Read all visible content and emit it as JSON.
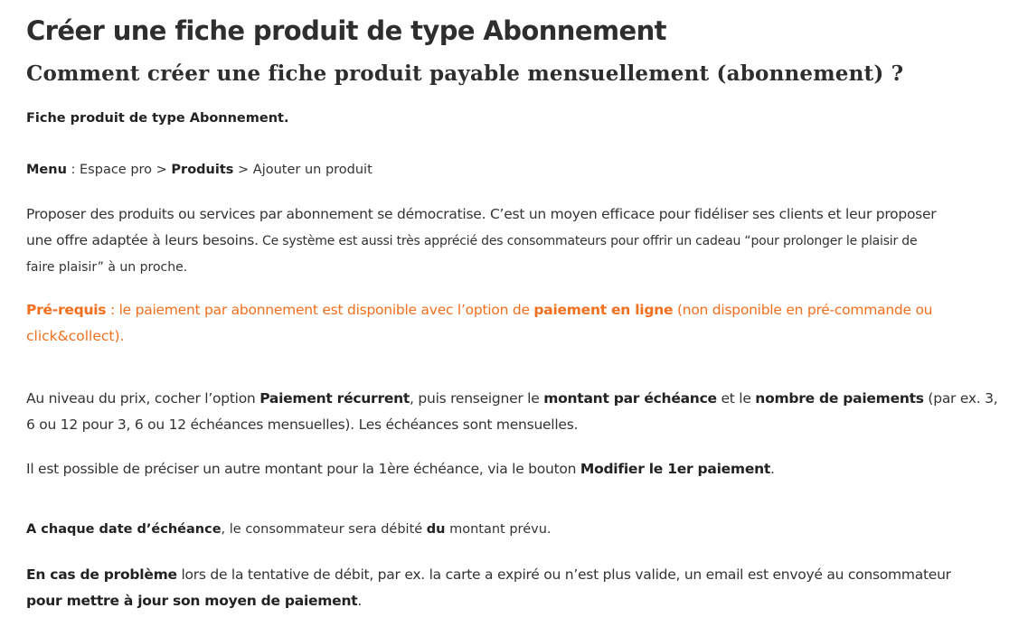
{
  "title": "Créer une fiche produit de type Abonnement",
  "subtitle": "Comment créer une fiche produit payable mensuellement (abonnement) ?",
  "intro": "Fiche produit de type Abonnement.",
  "breadcrumb": {
    "menu_label": "Menu",
    "sep1": " : Espace pro > ",
    "produits_label": "Produits",
    "sep2": " > Ajouter un produit"
  },
  "para1": {
    "line1": "Proposer des produits ou services par abonnement se démocratise. C’est un moyen efficace pour fidéliser ses clients et leur proposer",
    "line2a": "une offre adaptée à leurs besoins.",
    "line2b": " Ce système est aussi très apprécié des consommateurs pour offrir un cadeau “pour prolonger le plaisir de",
    "line3": "faire plaisir” à un proche."
  },
  "prerequis": {
    "label": "Pré-requis",
    "text1": " : le paiement par abonnement est disponible avec l’option de ",
    "bold": "paiement en ligne",
    "text2": " (non disponible en pré-commande ou",
    "line2": "click&collect)."
  },
  "para_prix": {
    "t1": "Au niveau du prix, cocher l’option ",
    "b1": "Paiement récurrent",
    "t2": ", puis renseigner le ",
    "b2": "montant par échéance",
    "t3": " et le ",
    "b3": "nombre de paiements",
    "t4": " (par ex. 3,",
    "line2": "6 ou 12 pour 3, 6 ou 12 échéances mensuelles). Les échéances sont mensuelles."
  },
  "para_modif": {
    "t1": "Il est possible de préciser un autre montant pour la 1ère échéance, via le bouton ",
    "b1": "Modifier le 1er paiement",
    "t2": "."
  },
  "para_date": {
    "b1": "A chaque date d’échéance",
    "t1": ", le consommateur sera débité ",
    "b2": "du",
    "t2": " montant prévu."
  },
  "para_probleme": {
    "b1": "En cas de problème",
    "t1": " lors de la tentative de débit, par ex. la carte a expiré ou n’est plus valide, un email est envoyé au consommateur",
    "b2": "pour mettre à jour son moyen de paiement",
    "t2": "."
  },
  "colors": {
    "text": "#333333",
    "heading": "#2e2e2e",
    "accent": "#f26f1d",
    "background": "#ffffff"
  }
}
